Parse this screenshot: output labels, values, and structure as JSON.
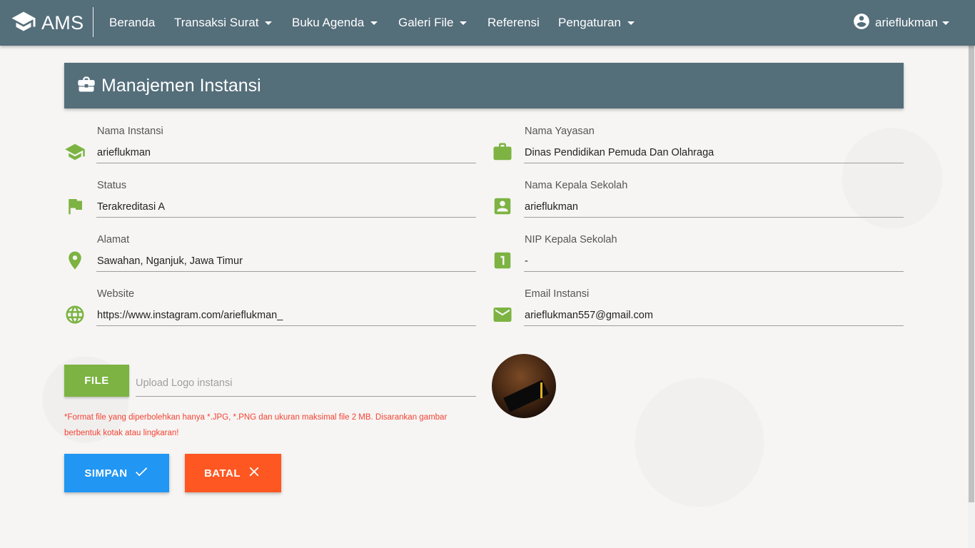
{
  "colors": {
    "navbar": "#546e7a",
    "icon_green": "#7cb342",
    "file_button": "#7cb342",
    "save_button": "#2196f3",
    "cancel_button": "#ff5722",
    "note_red": "#f44336"
  },
  "navbar": {
    "brand": "AMS",
    "brand_icon": "graduation-cap-icon",
    "items": [
      {
        "label": "Beranda",
        "dropdown": false
      },
      {
        "label": "Transaksi Surat",
        "dropdown": true
      },
      {
        "label": "Buku Agenda",
        "dropdown": true
      },
      {
        "label": "Galeri File",
        "dropdown": true
      },
      {
        "label": "Referensi",
        "dropdown": false
      },
      {
        "label": "Pengaturan",
        "dropdown": true
      }
    ],
    "user": {
      "name": "arieflukman",
      "icon": "account-circle-icon"
    }
  },
  "panel": {
    "title": "Manajemen Instansi",
    "icon": "briefcase-icon"
  },
  "form": {
    "left": [
      {
        "label": "Nama Instansi",
        "value": "arieflukman",
        "icon": "graduation-cap-icon"
      },
      {
        "label": "Status",
        "value": "Terakreditasi A",
        "icon": "flag-icon"
      },
      {
        "label": "Alamat",
        "value": "Sawahan, Nganjuk, Jawa Timur",
        "icon": "location-pin-icon"
      },
      {
        "label": "Website",
        "value": "https://www.instagram.com/arieflukman_",
        "icon": "globe-icon"
      }
    ],
    "right": [
      {
        "label": "Nama Yayasan",
        "value": "Dinas Pendidikan Pemuda Dan Olahraga",
        "icon": "briefcase-icon"
      },
      {
        "label": "Nama Kepala Sekolah",
        "value": "arieflukman",
        "icon": "contact-card-icon"
      },
      {
        "label": "NIP Kepala Sekolah",
        "value": "-",
        "icon": "number-one-box-icon"
      },
      {
        "label": "Email Instansi",
        "value": "arieflukman557@gmail.com",
        "icon": "email-icon"
      }
    ]
  },
  "upload": {
    "button_label": "FILE",
    "placeholder": "Upload Logo instansi",
    "note": "*Format file yang diperbolehkan hanya *.JPG, *.PNG dan ukuran maksimal file 2 MB. Disarankan gambar berbentuk kotak atau lingkaran!"
  },
  "actions": {
    "save_label": "SIMPAN",
    "save_icon": "check-icon",
    "cancel_label": "BATAL",
    "cancel_icon": "close-icon"
  }
}
